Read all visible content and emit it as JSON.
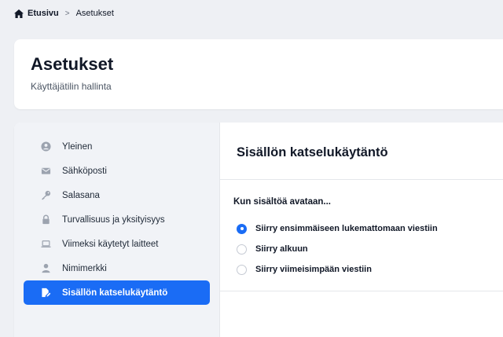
{
  "breadcrumb": {
    "home_label": "Etusivu",
    "separator": ">",
    "current": "Asetukset"
  },
  "header": {
    "title": "Asetukset",
    "subtitle": "Käyttäjätilin hallinta"
  },
  "sidebar": {
    "items": [
      {
        "label": "Yleinen",
        "icon": "user-circle-icon"
      },
      {
        "label": "Sähköposti",
        "icon": "envelope-icon"
      },
      {
        "label": "Salasana",
        "icon": "key-icon"
      },
      {
        "label": "Turvallisuus ja yksityisyys",
        "icon": "lock-icon"
      },
      {
        "label": "Viimeksi käytetyt laitteet",
        "icon": "laptop-icon"
      },
      {
        "label": "Nimimerkki",
        "icon": "user-icon"
      },
      {
        "label": "Sisällön katselukäytäntö",
        "icon": "file-edit-icon",
        "active": true
      }
    ]
  },
  "content": {
    "title": "Sisällön katselukäytäntö",
    "question": "Kun sisältöä avataan...",
    "options": [
      {
        "label": "Siirry ensimmäiseen lukemattomaan viestiin",
        "checked": true
      },
      {
        "label": "Siirry alkuun",
        "checked": false
      },
      {
        "label": "Siirry viimeisimpään viestiin",
        "checked": false
      }
    ]
  },
  "colors": {
    "accent": "#1a6cf5",
    "background": "#eef0f4",
    "sidebar_bg": "#f1f3f7"
  }
}
